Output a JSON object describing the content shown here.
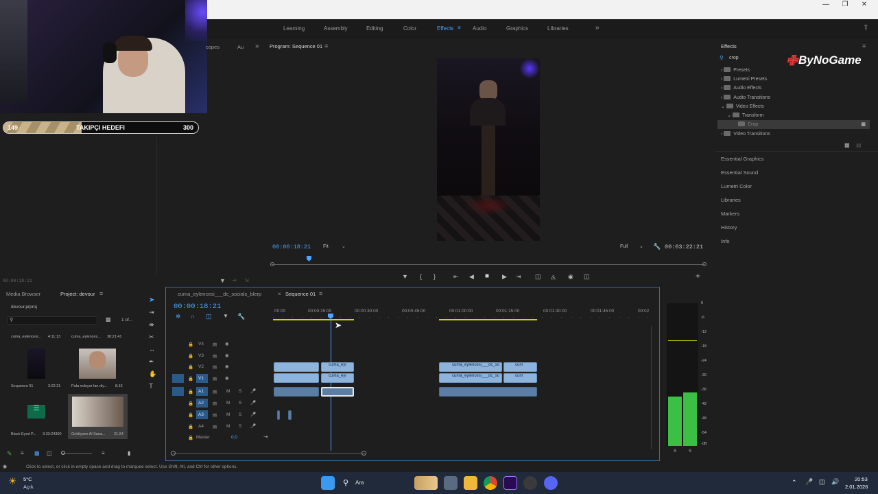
{
  "workspaces": {
    "tabs": [
      "Learning",
      "Assembly",
      "Editing",
      "Color",
      "Effects",
      "Audio",
      "Graphics",
      "Libraries"
    ],
    "active": "Effects"
  },
  "overlay": {
    "goal_start": "149",
    "goal_label": "TAKIPÇI HEDEFI",
    "goal_end": "300"
  },
  "source_panel": {
    "tab_scopes": "copes",
    "tab_au": "Au",
    "timecode": "00:00:18:21"
  },
  "program": {
    "title": "Program: Sequence 01",
    "timecode": "00:00:18:21",
    "fit": "Fit",
    "full": "Full",
    "duration": "00:03:22:21"
  },
  "effects": {
    "title": "Effects",
    "search_value": "crop",
    "brand": "ByNoGame",
    "tree": [
      {
        "label": "Presets",
        "level": 0
      },
      {
        "label": "Lumetri Presets",
        "level": 0
      },
      {
        "label": "Audio Effects",
        "level": 0
      },
      {
        "label": "Audio Transitions",
        "level": 0
      },
      {
        "label": "Video Effects",
        "level": 0
      },
      {
        "label": "Transform",
        "level": 1
      },
      {
        "label": "Crop",
        "level": 2
      },
      {
        "label": "Video Transitions",
        "level": 0
      }
    ],
    "sections": [
      "Essential Graphics",
      "Essential Sound",
      "Lumetri Color",
      "Libraries",
      "Markers",
      "History",
      "Info"
    ]
  },
  "project": {
    "tab_media": "Media Browser",
    "tab_project": "Project: devour",
    "file": "devour.prproj",
    "count": "1 of...",
    "items": [
      {
        "name": "cuma_eylencesi...",
        "dur": "4:11:13"
      },
      {
        "name": "cuma_eylences...",
        "dur": "38:21:41"
      },
      {
        "name": "Sequence 01",
        "dur": "3:22:21"
      },
      {
        "name": "Pala noluyor lan diy...",
        "dur": "8;16"
      },
      {
        "name": "Black Eyed P...",
        "dur": "3:33:24300"
      },
      {
        "name": "Geldiysen Al Sana...",
        "dur": "21:24"
      }
    ]
  },
  "timeline": {
    "tab_clip": "cuma_eylencesi___dc_socials_blerp",
    "tab_seq": "Sequence 01",
    "timecode": "00:00:18:21",
    "ruler": [
      "00:00",
      "00:00:15:00",
      "00:00:30:00",
      "00:00:45:00",
      "00:01:00:00",
      "00:01:15:00",
      "00:01:30:00",
      "00:01:45:00",
      "00:02"
    ],
    "video_tracks": [
      "V4",
      "V3",
      "V2",
      "V1"
    ],
    "audio_tracks": [
      "A1",
      "A2",
      "A3",
      "A4"
    ],
    "master_label": "Master",
    "master_value": "0,0",
    "clip_label_1": "cuma_eyl",
    "clip_label_2": "cuma_eylencesi___dc_so",
    "clip_label_3": "cum",
    "ms": [
      "M",
      "S"
    ]
  },
  "meter": {
    "scale": [
      "0",
      "-6",
      "-12",
      "-18",
      "-24",
      "-30",
      "-36",
      "-42",
      "-48",
      "-54",
      "-dB"
    ],
    "solo": [
      "S",
      "S"
    ]
  },
  "status": {
    "message": "Click to select, or click in empty space and drag to marquee select. Use Shift, Alt, and Ctrl for other options."
  },
  "taskbar": {
    "weather_temp": "5°C",
    "weather_desc": "Açık",
    "search": "Ara",
    "time": "20:53",
    "date": "2.01.2026"
  }
}
